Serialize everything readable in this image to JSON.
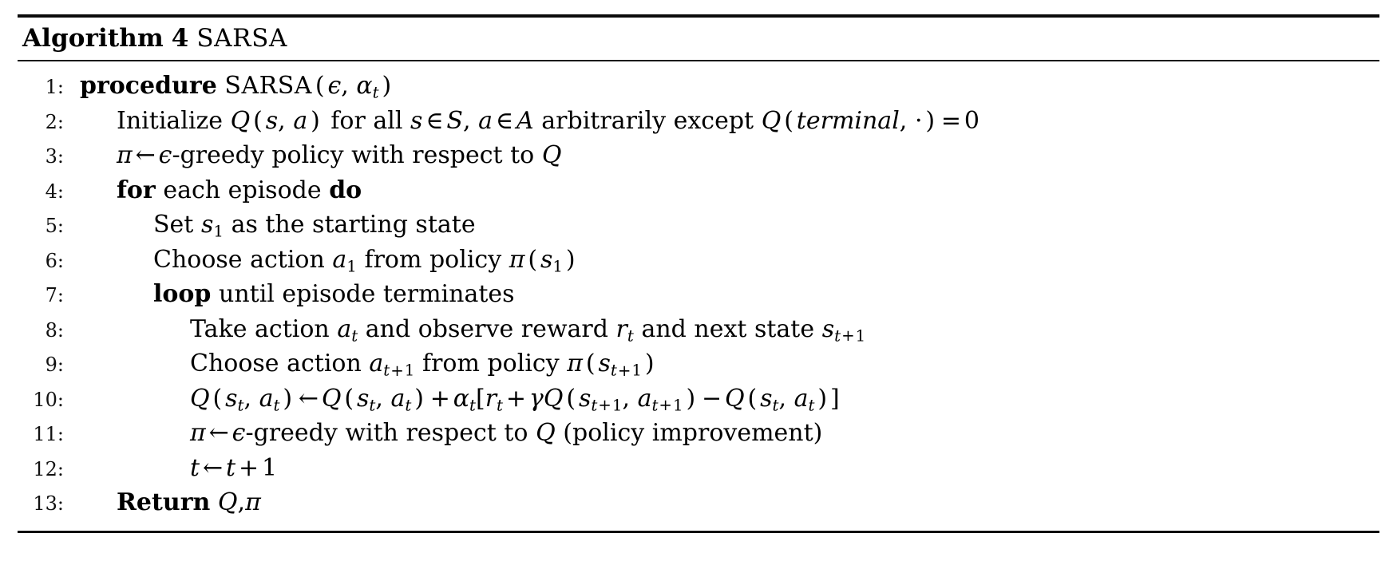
{
  "caption": {
    "label": "Algorithm",
    "number": "4",
    "title": "SARSA"
  },
  "lines": [
    {
      "num": "1:",
      "indent": 0,
      "text": "procedure SARSA(ϵ, αₜ)"
    },
    {
      "num": "2:",
      "indent": 1,
      "text": "Initialize Q(s, a) for all s ∈ S, a ∈ A arbitrarily except Q(terminal, ·) = 0"
    },
    {
      "num": "3:",
      "indent": 1,
      "text": "π ← ϵ-greedy policy with respect to Q"
    },
    {
      "num": "4:",
      "indent": 1,
      "text": "for each episode do"
    },
    {
      "num": "5:",
      "indent": 2,
      "text": "Set s₁ as the starting state"
    },
    {
      "num": "6:",
      "indent": 2,
      "text": "Choose action a₁ from policy π(s₁)"
    },
    {
      "num": "7:",
      "indent": 2,
      "text": "loop until episode terminates"
    },
    {
      "num": "8:",
      "indent": 3,
      "text": "Take action aₜ and observe reward rₜ and next state sₜ₊₁"
    },
    {
      "num": "9:",
      "indent": 3,
      "text": "Choose action aₜ₊₁ from policy π(sₜ₊₁)"
    },
    {
      "num": "10:",
      "indent": 3,
      "text": "Q(sₜ, aₜ) ← Q(sₜ, aₜ) + αₜ[rₜ + γQ(sₜ₊₁, aₜ₊₁) − Q(sₜ, aₜ)]"
    },
    {
      "num": "11:",
      "indent": 3,
      "text": "π ← ϵ-greedy with respect to Q (policy improvement)"
    },
    {
      "num": "12:",
      "indent": 3,
      "text": "t ← t + 1"
    },
    {
      "num": "13:",
      "indent": 1,
      "text": "Return Q, π"
    }
  ],
  "tokens": {
    "procedure": "procedure",
    "sarsa": "SARSA",
    "for": "for",
    "each_episode": "each episode",
    "do": "do",
    "loop": "loop",
    "until_terminates": "until episode terminates",
    "initialize": "Initialize",
    "for_all": "for all",
    "arbitrarily_except": "arbitrarily except",
    "greedy_policy": "-greedy policy with respect to",
    "greedy_respect": "-greedy with respect to",
    "policy_improvement": "(policy improvement)",
    "set": "Set",
    "as_starting_state": "as the starting state",
    "choose_action": "Choose action",
    "from_policy": "from policy",
    "take_action": "Take action",
    "and_observe_reward": "and observe reward",
    "and_next_state": "and next state",
    "return": "Return",
    "terminal": "terminal",
    "zero": "0",
    "one": "1",
    "eq": "=",
    "plus": "+",
    "minus": "−",
    "gets": "←",
    "in": "∈",
    "comma": ",",
    "cdot": "·",
    "lparen": "(",
    "rparen": ")",
    "lbrack": "[",
    "rbrack": "]",
    "eps": "ϵ",
    "alpha": "α",
    "gamma": "γ",
    "pi": "π",
    "Q": "Q",
    "S": "S",
    "A": "A",
    "s": "s",
    "a": "a",
    "r": "r",
    "t": "t"
  }
}
